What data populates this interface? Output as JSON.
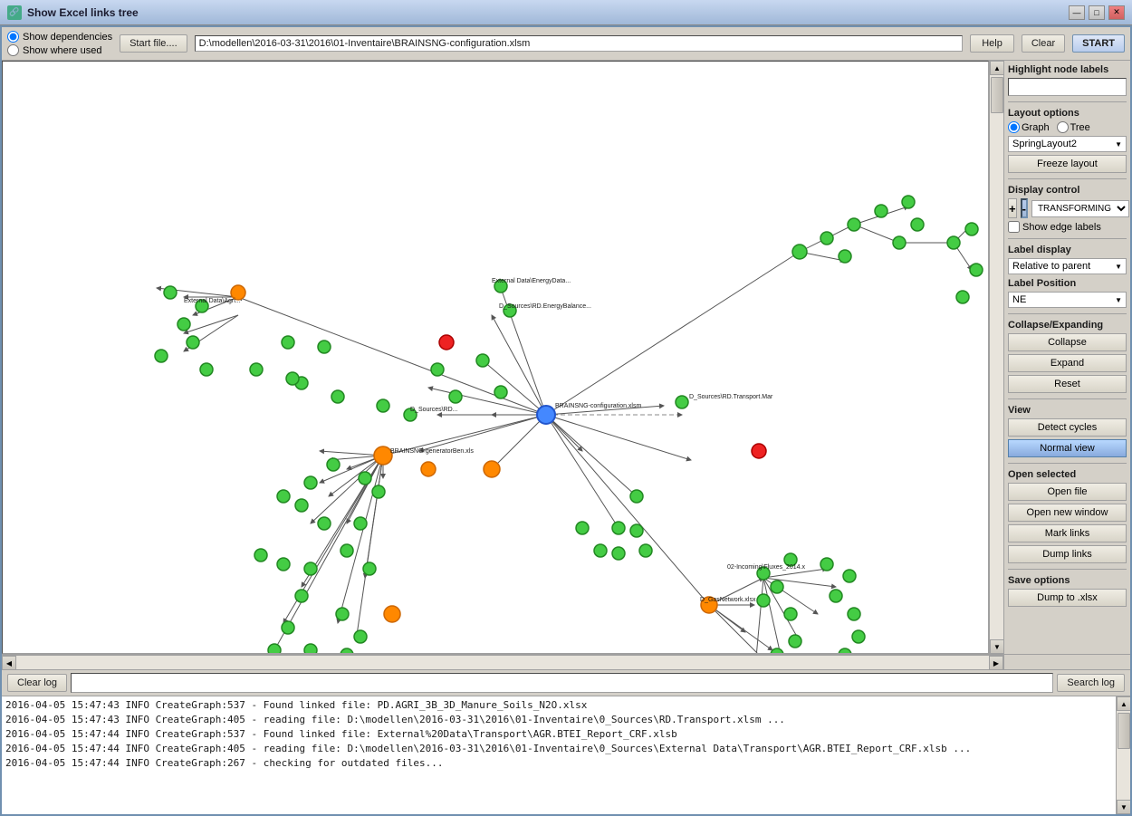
{
  "titlebar": {
    "title": "Show Excel links tree",
    "icon": "🔗",
    "btn_minimize": "—",
    "btn_maximize": "□",
    "btn_close": "✕"
  },
  "toolbar": {
    "radio_dependencies": "Show dependencies",
    "radio_where_used": "Show where used",
    "start_file_label": "Start file....",
    "file_path": "D:\\modellen\\2016-03-31\\2016\\01-Inventaire\\BRAINSNG-configuration.xlsm",
    "help_label": "Help",
    "clear_label": "Clear",
    "start_label": "START"
  },
  "right_panel": {
    "highlight_section": "Highlight node labels",
    "highlight_placeholder": "",
    "layout_options_label": "Layout options",
    "radio_graph": "Graph",
    "radio_tree": "Tree",
    "layout_dropdown": "SpringLayout2",
    "freeze_label": "Freeze layout",
    "display_control_label": "Display control",
    "dc_plus": "+",
    "dc_minus": "-",
    "dc_dropdown": "TRANSFORMING",
    "show_edge_labels": "Show edge labels",
    "label_display_label": "Label display",
    "label_display_dropdown": "Relative to parent",
    "label_position_label": "Label Position",
    "label_position_dropdown": "NE",
    "collapse_expanding_label": "Collapse/Expanding",
    "collapse_label": "Collapse",
    "expand_label": "Expand",
    "reset_label": "Reset",
    "view_label": "View",
    "detect_cycles_label": "Detect cycles",
    "normal_view_label": "Normal view",
    "open_selected_label": "Open selected",
    "open_file_label": "Open file",
    "open_new_window_label": "Open new window",
    "mark_links_label": "Mark links",
    "dump_links_label": "Dump links",
    "save_options_label": "Save options",
    "dump_xlsx_label": "Dump to .xlsx"
  },
  "log": {
    "clear_label": "Clear log",
    "search_label": "Search log",
    "search_placeholder": "",
    "entries": [
      "2016-04-05  15:47:43  INFO  CreateGraph:537 - Found linked file: PD.AGRI_3B_3D_Manure_Soils_N2O.xlsx",
      "2016-04-05  15:47:43  INFO  CreateGraph:405 - reading file: D:\\modellen\\2016-03-31\\2016\\01-Inventaire\\0_Sources\\RD.Transport.xlsm ...",
      "2016-04-05  15:47:44  INFO  CreateGraph:537 - Found linked file: External%20Data\\Transport\\AGR.BTEI_Report_CRF.xlsb",
      "2016-04-05  15:47:44  INFO  CreateGraph:405 - reading file: D:\\modellen\\2016-03-31\\2016\\01-Inventaire\\0_Sources\\External Data\\Transport\\AGR.BTEI_Report_CRF.xlsb ...",
      "2016-04-05  15:47:44  INFO  CreateGraph:267 - checking for outdated files..."
    ]
  }
}
